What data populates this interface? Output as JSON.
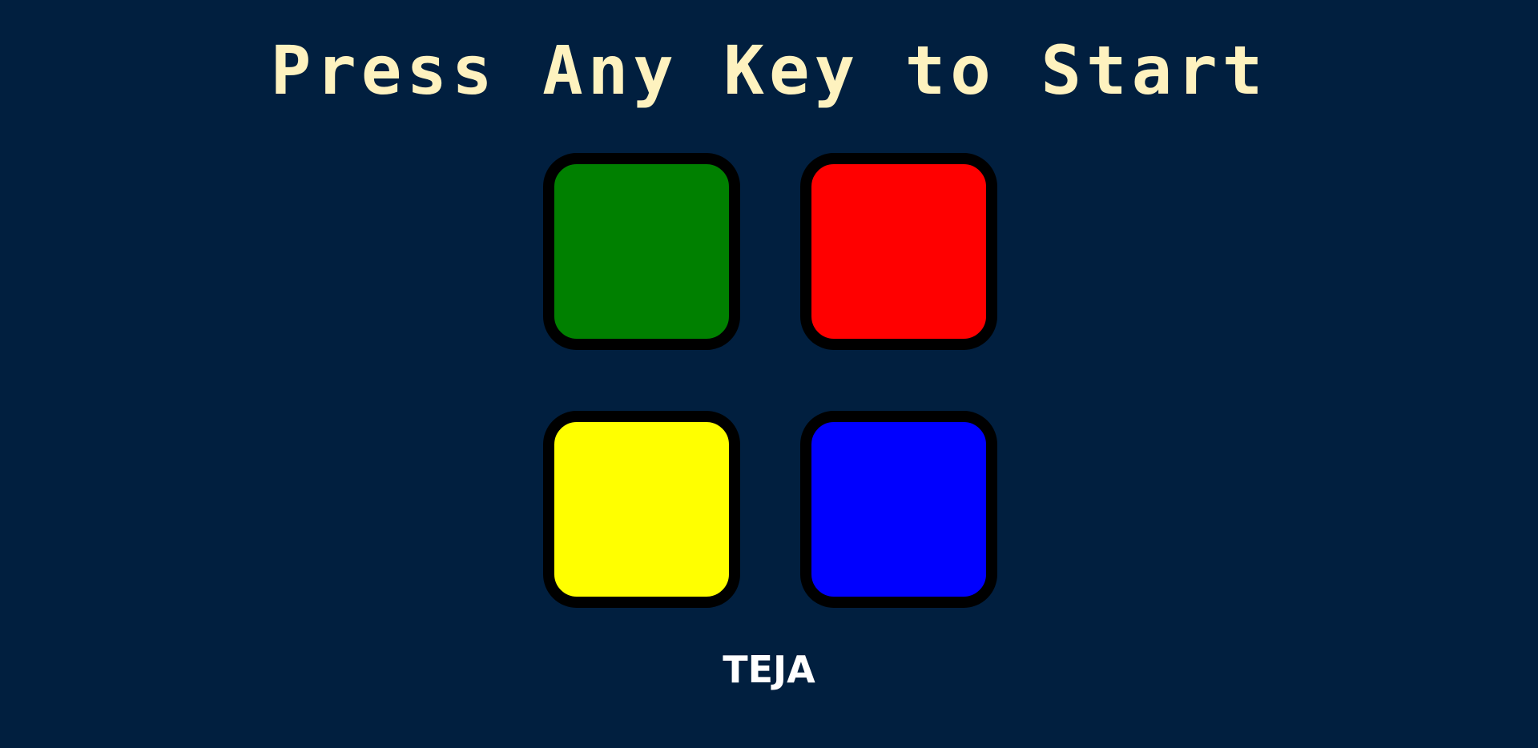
{
  "title": "Press Any Key to Start",
  "colors": {
    "background": "#011f3f",
    "title_text": "#fef2bf",
    "pad_border": "#000000",
    "footer_text": "#ffffff"
  },
  "pads": [
    {
      "id": "green",
      "color": "#008000"
    },
    {
      "id": "red",
      "color": "#ff0000"
    },
    {
      "id": "yellow",
      "color": "#ffff00"
    },
    {
      "id": "blue",
      "color": "#0000ff"
    }
  ],
  "footer": {
    "name": "TEJA"
  }
}
